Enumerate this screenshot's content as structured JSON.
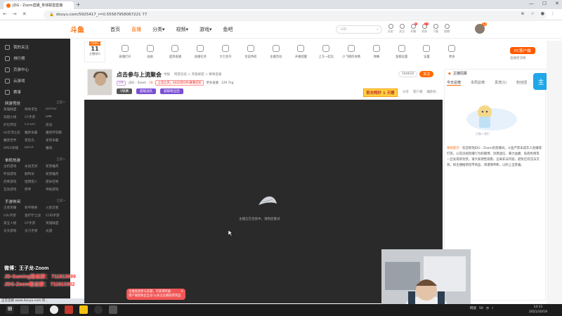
{
  "browser": {
    "tab_title": "JDG - Zoom直播_单体联盟直播",
    "new_tab": "+",
    "url": "douyu.com/5925417_r=0.55567958067221 77",
    "controls": [
      "—",
      "☐",
      "✕"
    ],
    "nav": [
      "←",
      "→",
      "✕"
    ]
  },
  "site": {
    "logo": "斗鱼",
    "nav": [
      "首页",
      "直播",
      "分类▾",
      "视频▾",
      "游戏▾",
      "鱼吧"
    ],
    "active_nav_index": 1,
    "search_placeholder": "UZI",
    "header_icons": [
      {
        "label": "历史",
        "badge": ""
      },
      {
        "label": "关注",
        "badge": ""
      },
      {
        "label": "开播",
        "badge": "6"
      },
      {
        "label": "消息",
        "badge": "20"
      },
      {
        "label": "下载",
        "badge": ""
      },
      {
        "label": "鱼粮",
        "badge": ""
      }
    ],
    "avatar_badge": "12"
  },
  "sidebar": {
    "top_items": [
      "我的关注",
      "排行榜",
      "页游中心",
      "云游戏",
      "赛事"
    ],
    "sections": [
      {
        "title": "网游竞技",
        "more": "全部>",
        "games": [
          "英雄联盟",
          "绝地求生",
          "DOTA2",
          "穿越火线",
          "CF手游",
          "DNF",
          "炉石传说",
          "CS:GO",
          "逆战",
          "lol云顶之弈",
          "魔兽争霸",
          "魔兽怀旧服",
          "魔兽世界",
          "冒险岛",
          "星际争霸",
          "APEX英雄",
          "DOTA",
          "魔域"
        ]
      },
      {
        "title": "单机热游",
        "more": "全部>",
        "games": [
          "主机游戏",
          "永劫无间",
          "新游推荐",
          "怀旧游戏",
          "鹅鸭杀",
          "新游推荐",
          "恐怖游戏",
          "怪物猎人",
          "使命召唤",
          "互动游戏",
          "原神",
          "神秘游戏"
        ]
      },
      {
        "title": "手游休闲",
        "more": "全部>",
        "games": [
          "王者荣耀",
          "和平精英",
          "火影忍者",
          "LOL手游",
          "金铲铲之战",
          "COD手游",
          "第五人格",
          "CF手游",
          "英雄联盟",
          "天天游戏",
          "天刀手游",
          "光遇"
        ]
      }
    ],
    "overlay_lines": [
      {
        "text": "微博：王子龙-Zoom",
        "color": "#ffffff"
      },
      {
        "text": "JD-Gaming粉丝群：  711813099",
        "color": "#ff3b3b"
      },
      {
        "text": "JDG-Zoom粉丝群：  711813382",
        "color": "#ff3b3b"
      }
    ]
  },
  "toolbar": {
    "rank_tag": "月排行",
    "rank_num": "11",
    "rank_label": "主播排行",
    "tools": [
      "直播打开",
      "画质",
      "超清直播",
      "直播任务",
      "大力金丹",
      "金鲨特权",
      "主播活动",
      "开播提醒",
      "上车一起玩",
      "小飞猪的攻略",
      "弹幕",
      "鱼粮设置",
      "设置",
      "更多"
    ],
    "pc_client": "PC客户端",
    "pc_sub": "直播更流畅"
  },
  "room": {
    "title": "点击参与上流聚会",
    "category": [
      "举报",
      "网游竞技 > 英雄联盟 > 赛事直播"
    ],
    "streamer_name": "JDG - Zoom",
    "level": "18",
    "notice": "上流之声，2020年OPL赛事冠军",
    "meta": [
      "更多直播",
      "129.7kg"
    ],
    "badges": [
      "V联赛",
      "超级战队",
      "超级粉丝团"
    ],
    "follow_count": "544610",
    "follow_label": "关注",
    "first_charge": "首充鸭秒 1 天赠",
    "share": [
      "分享",
      "客户端",
      "摄影机"
    ]
  },
  "player": {
    "loading_text": "主播正在连接中，请稍后重试"
  },
  "chat": {
    "header": "主播招募",
    "tabs": [
      "今日总榜",
      "本周总榜",
      "贵宾(1)",
      "粉丝团"
    ],
    "img_caption": "召集人我们",
    "sys_label": "系统提示：",
    "sys_msg": "欢迎来到JDG - Zoom的直播间。斗鱼严禁未成年人直播或打赏。以及违规直播行为如赌博、封建迷信、暴力血腥、低俗色情等一旦发现即封禁。请大家理性观看，远离非法内容，避免任何违法交易。如主播推销宣传商品，请谨慎判断，以防上当受骗。"
  },
  "toast": {
    "line1": "主播直接参与答题，可获得奖励",
    "line2": "用户搜索粉丝互动 以关注主播获得奖品",
    "close": "✕"
  },
  "status_bar": "正在连接 www.douyu.com 的...",
  "taskbar": {
    "tray": [
      "网速",
      "50"
    ],
    "time": "14:11",
    "date": "2021/10/19"
  }
}
